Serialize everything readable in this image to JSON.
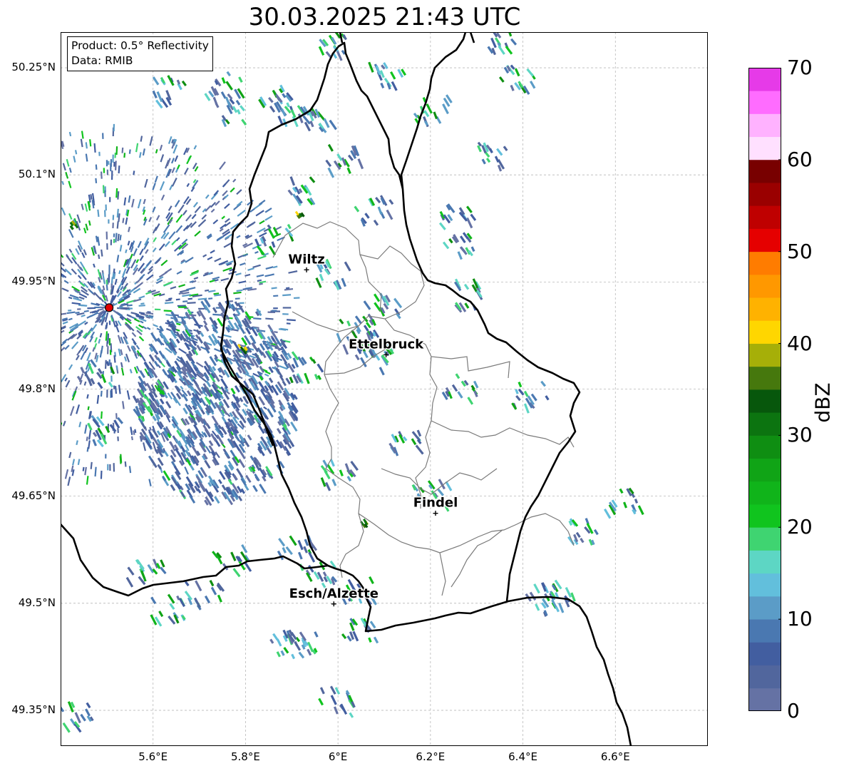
{
  "title": "30.03.2025 21:43 UTC",
  "info": {
    "product": "Product: 0.5° Reflectivity",
    "source": "Data: RMIB"
  },
  "map": {
    "extent": {
      "lon": [
        5.4,
        6.8
      ],
      "lat": [
        49.3,
        50.3
      ]
    },
    "lat_ticks": [
      {
        "value": 50.25,
        "label": "50.25°N"
      },
      {
        "value": 50.1,
        "label": "50.1°N"
      },
      {
        "value": 49.95,
        "label": "49.95°N"
      },
      {
        "value": 49.8,
        "label": "49.8°N"
      },
      {
        "value": 49.65,
        "label": "49.65°N"
      },
      {
        "value": 49.5,
        "label": "49.5°N"
      },
      {
        "value": 49.35,
        "label": "49.35°N"
      }
    ],
    "lon_ticks": [
      {
        "value": 5.6,
        "label": "5.6°E"
      },
      {
        "value": 5.8,
        "label": "5.8°E"
      },
      {
        "value": 6.0,
        "label": "6°E"
      },
      {
        "value": 6.2,
        "label": "6.2°E"
      },
      {
        "value": 6.4,
        "label": "6.4°E"
      },
      {
        "value": 6.6,
        "label": "6.6°E"
      }
    ],
    "grid": true,
    "radar_site": {
      "lon": 5.505,
      "lat": 49.914,
      "color": "#e00000"
    },
    "cities": [
      {
        "name": "Wiltz",
        "lon": 5.932,
        "lat": 49.967
      },
      {
        "name": "Ettelbruck",
        "lon": 6.104,
        "lat": 49.848
      },
      {
        "name": "Findel",
        "lon": 6.211,
        "lat": 49.626
      },
      {
        "name": "Esch/Alzette",
        "lon": 5.991,
        "lat": 49.499
      }
    ]
  },
  "colorbar": {
    "label": "dBZ",
    "min": 0,
    "max": 70,
    "step": 2.5,
    "ticks": [
      {
        "value": 0,
        "label": "0"
      },
      {
        "value": 10,
        "label": "10"
      },
      {
        "value": 20,
        "label": "20"
      },
      {
        "value": 30,
        "label": "30"
      },
      {
        "value": 40,
        "label": "40"
      },
      {
        "value": 50,
        "label": "50"
      },
      {
        "value": 60,
        "label": "60"
      },
      {
        "value": 70,
        "label": "70"
      }
    ],
    "colors": [
      "#6572a4",
      "#51669d",
      "#425ea0",
      "#4a78b1",
      "#5b9cc7",
      "#62bfdc",
      "#5dd6c4",
      "#3fd471",
      "#10c41e",
      "#10b41a",
      "#10a416",
      "#0f8e12",
      "#0c7410",
      "#07570c",
      "#46780d",
      "#a6af08",
      "#ffd600",
      "#ffb200",
      "#ff9800",
      "#ff7c00",
      "#e50000",
      "#bf0000",
      "#9a0000",
      "#780000",
      "#ffe0ff",
      "#ffb2ff",
      "#ff6cff",
      "#e63ae8"
    ]
  }
}
